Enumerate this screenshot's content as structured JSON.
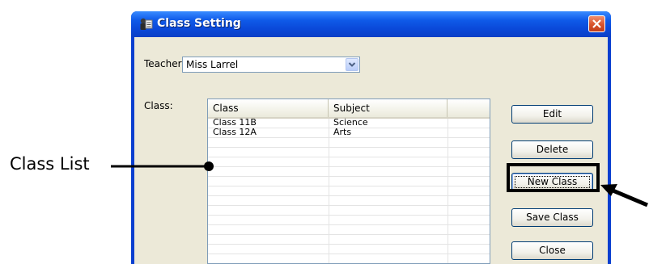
{
  "annotation": {
    "label": "Class List"
  },
  "window": {
    "title": "Class Setting",
    "teacher_label": "Teacher:",
    "teacher_value": "Miss Larrel",
    "class_label": "Class:"
  },
  "list": {
    "columns": [
      "Class",
      "Subject"
    ],
    "rows": [
      {
        "class": "Class 11B",
        "subject": "Science"
      },
      {
        "class": "Class 12A",
        "subject": "Arts"
      }
    ]
  },
  "buttons": {
    "edit": "Edit",
    "delete": "Delete",
    "new_class": "New Class",
    "save_class": "Save Class",
    "close": "Close"
  },
  "colors": {
    "titlebar": "#0a4ad8",
    "client": "#ece9d8",
    "close_button": "#d8532c"
  }
}
